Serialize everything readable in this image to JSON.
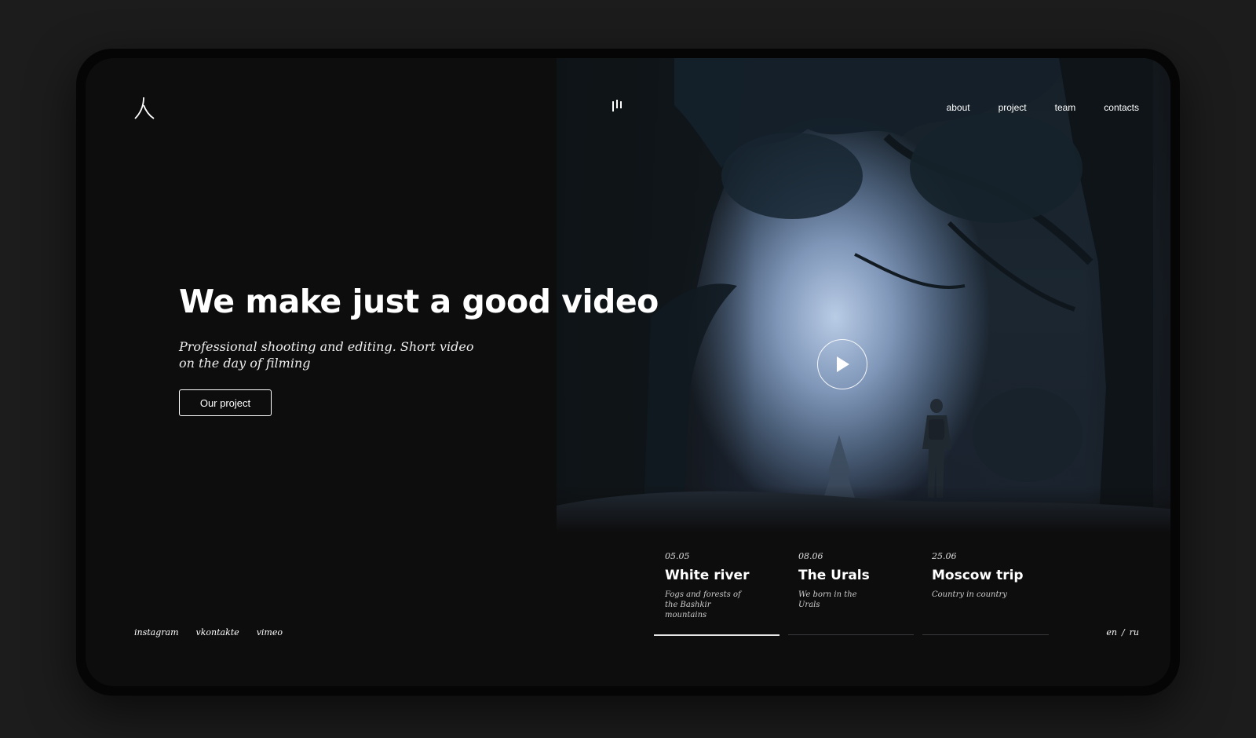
{
  "header": {
    "logo_icon": "person-glyph-logo",
    "menu_icon": "equalizer-menu-icon",
    "nav": [
      "about",
      "project",
      "team",
      "contacts"
    ]
  },
  "hero": {
    "title": "We make just a good video",
    "subtitle_line1": "Professional shooting and editing. Short video",
    "subtitle_line2": "on the day of filming",
    "cta_label": "Our project",
    "play_icon": "play-icon"
  },
  "projects": [
    {
      "date": "05.05",
      "title": "White river",
      "desc": "Fogs and forests of the Bashkir mountains"
    },
    {
      "date": "08.06",
      "title": "The Urals",
      "desc": "We born in the Urals"
    },
    {
      "date": "25.06",
      "title": "Moscow trip",
      "desc": "Country in country"
    }
  ],
  "slider": {
    "active_index": 0,
    "count": 3
  },
  "footer": {
    "socials": [
      "instagram",
      "vkontakte",
      "vimeo"
    ],
    "lang": {
      "en": "en",
      "sep": "/",
      "ru": "ru"
    }
  },
  "colors": {
    "background": "#0d0d0e",
    "page": "#1c1c1d",
    "text": "#ffffff",
    "mist": "#b9cce6"
  }
}
